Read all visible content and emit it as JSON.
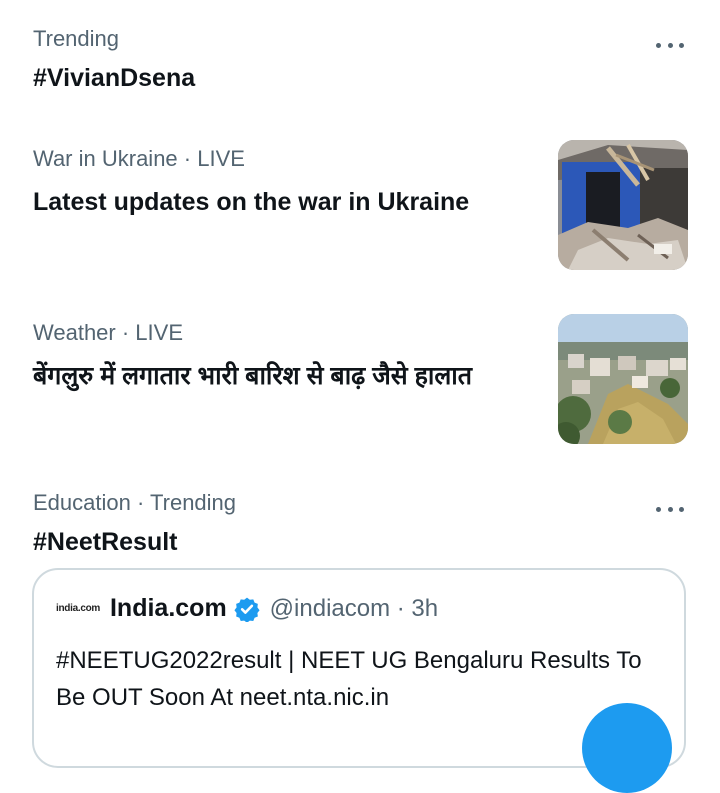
{
  "trends": [
    {
      "context": "Trending",
      "title": "#VivianDsena",
      "has_more": true
    },
    {
      "context": "War in Ukraine · LIVE",
      "title": "Latest updates on the war in Ukraine",
      "image": "destroyed-building-photo"
    },
    {
      "context": "Weather · LIVE",
      "title": "बेंगलुरु में लगातार भारी बारिश से बाढ़ जैसे हालात",
      "image": "flooded-city-aerial-photo"
    },
    {
      "context": "Education · Trending",
      "title": "#NeetResult",
      "has_more": true,
      "tweet": {
        "source_logo": "india.com",
        "source_name": "India.com",
        "handle_time": "@indiacom · 3h",
        "text": "#NEETUG2022result  | NEET UG Bengaluru Results To Be OUT Soon At neet.nta.nic.in",
        "verified_icon": "verified-badge-icon"
      }
    }
  ],
  "colors": {
    "primary_text": "#0f1419",
    "secondary_text": "#536471",
    "border": "#cfd9de",
    "accent": "#1d9bf0"
  },
  "fab_icon": "compose-tweet-button"
}
